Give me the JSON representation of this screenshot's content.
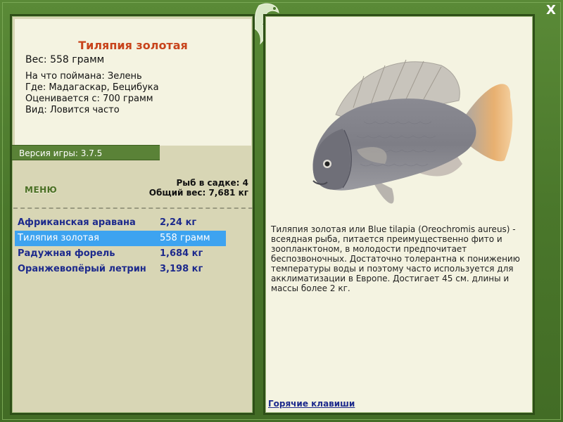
{
  "fish": {
    "title": "Тиляпия золотая",
    "weight": "Вес: 558 грамм",
    "caught_on": "На что поймана: Зелень",
    "location": "Где: Мадагаскар, Бецибука",
    "valued_at": "Оценивается с: 700 грамм",
    "kind": "Вид: Ловится часто"
  },
  "version": "Версия игры: 3.7.5",
  "menu_label": "МЕНЮ",
  "stats": {
    "fish_count": "Рыб в садке: 4",
    "total_weight": "Общий вес: 7,681 кг"
  },
  "fish_list": [
    {
      "name": "Африканская аравана",
      "weight": "2,24 кг",
      "selected": false
    },
    {
      "name": "Тиляпия золотая",
      "weight": "558 грамм",
      "selected": true
    },
    {
      "name": "Радужная форель",
      "weight": "1,684 кг",
      "selected": false
    },
    {
      "name": "Оранжевопёрый летрин",
      "weight": "3,198 кг",
      "selected": false
    }
  ],
  "description": "Тиляпия золотая или Blue tilapia (Oreochromis aureus) - всеядная рыба, питается преимущественно фито и зоопланктоном, в молодости предпочитает беспозвоночных. Достаточно толерантна к понижению температуры воды и поэтому часто используется для акклиматизации в Европе. Достигает 45 см. длины и массы более 2 кг.",
  "hotkeys": "Горячие клавиши",
  "close_symbol": "X",
  "icons": {
    "close": "close-icon",
    "logo": "fish-logo-icon"
  },
  "colors": {
    "title": "#c8441c",
    "list_text": "#1d2a8c",
    "selected_bg": "#3da3f0",
    "frame": "#4d7a2e"
  }
}
